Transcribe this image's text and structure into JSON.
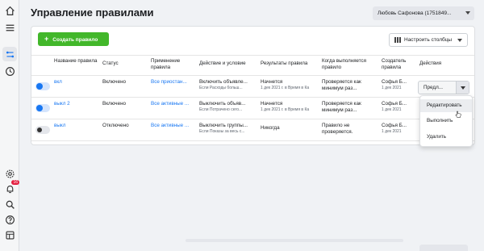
{
  "page": {
    "title": "Управление правилами"
  },
  "account": {
    "label": "Любовь Сафонова (1751849..."
  },
  "sidebar": {
    "icons": [
      "home-icon",
      "menu-icon",
      "rules-icon",
      "clock-icon",
      "settings-icon",
      "bell-icon",
      "search-icon",
      "help-icon",
      "panel-icon"
    ],
    "badge": "16"
  },
  "toolbar": {
    "create_label": "Создать правило",
    "columns_label": "Настроить столбцы"
  },
  "table": {
    "headers": {
      "name": "Название правила",
      "status": "Статус",
      "applied": "Применение правила",
      "action": "Действие и условие",
      "results": "Результаты правила",
      "when": "Когда выполняется правило",
      "creator": "Создатель правила",
      "actions": "Действия"
    },
    "rows": [
      {
        "name": "вкл",
        "status": "Включено",
        "applied": "Все приостан...",
        "action_main": "Включить объявле...",
        "action_sub": "Если Расходы больш...",
        "results_main": "Начнется",
        "results_sub": "1 дек 2021 г. в Время в Ка",
        "when": "Проверяется как минимум раз...",
        "creator_main": "Софья Б...",
        "creator_sub": "1 дек 2021",
        "toggle": "on",
        "action_button": "Предл..."
      },
      {
        "name": "выкл 2",
        "status": "Включено",
        "applied": "Все активные ...",
        "action_main": "Выключить объяв...",
        "action_sub": "Если Потрачено сего...",
        "results_main": "Начнется",
        "results_sub": "1 дек 2021 г. в Время в Ка",
        "when": "Проверяется как минимум раз...",
        "creator_main": "Софья Б...",
        "creator_sub": "1 дек 2021",
        "toggle": "on"
      },
      {
        "name": "выкл",
        "status": "Отключено",
        "applied": "Все активные ...",
        "action_main": "Выключить группы...",
        "action_sub": "Если Показы за весь с...",
        "results_main": "Никогда",
        "results_sub": "",
        "when": "Правило не проверяется.",
        "creator_main": "Софья Б...",
        "creator_sub": "1 дек 2021",
        "toggle": "off"
      }
    ]
  },
  "menu": {
    "items": [
      "Редактировать",
      "Выполнить",
      "Удалить"
    ]
  },
  "colors": {
    "accent": "#1877f2",
    "create": "#42b72a",
    "badge": "#e41e3f"
  }
}
